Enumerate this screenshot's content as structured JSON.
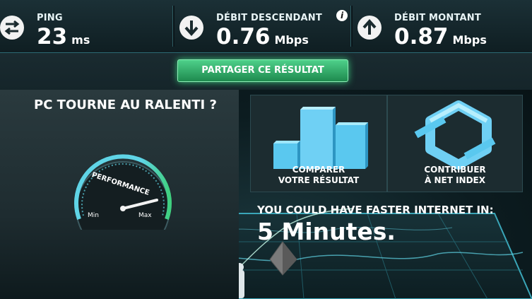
{
  "header": {
    "ping": {
      "label": "PING",
      "value": "23",
      "unit": "ms",
      "icon": "swap-arrows-icon"
    },
    "download": {
      "label": "DÉBIT DESCENDANT",
      "value": "0.76",
      "unit": "Mbps",
      "icon": "arrow-down-icon"
    },
    "upload": {
      "label": "DÉBIT MONTANT",
      "value": "0.87",
      "unit": "Mbps",
      "icon": "arrow-up-icon"
    },
    "info_glyph": "i"
  },
  "share": {
    "label": "PARTAGER CE RÉSULTAT"
  },
  "promo": {
    "title": "PC TOURNE AU RALENTI ?",
    "gauge_label": "PERFORMANCE",
    "gauge_min": "Min",
    "gauge_max": "Max",
    "gauge_level": 0.78
  },
  "tiles": {
    "compare": {
      "line1": "COMPARER",
      "line2": "VOTRE RÉSULTAT"
    },
    "contribute": {
      "line1": "CONTRIBUER",
      "line2": "À NET INDEX"
    }
  },
  "faster": {
    "text": "YOU COULD HAVE FASTER INTERNET IN:",
    "value": "5 Minutes."
  },
  "colors": {
    "accent_green": "#3fd07f",
    "accent_cyan": "#5fd4e6",
    "background": "#0a1418"
  }
}
